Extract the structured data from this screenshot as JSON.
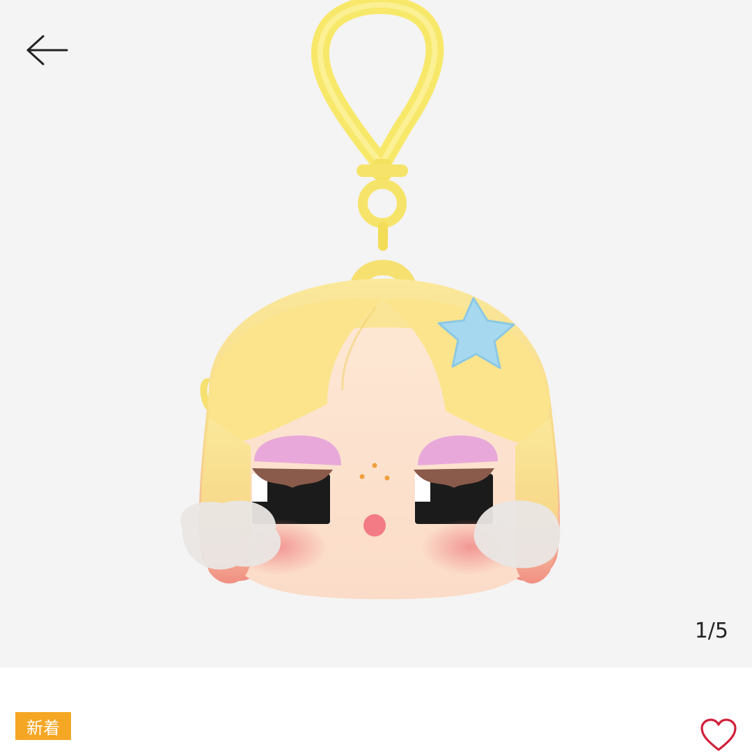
{
  "gallery": {
    "image_counter": "1/5",
    "product_image": "keychain-figure-head-image",
    "background_color": "#f4f4f4"
  },
  "header": {
    "back_icon": "arrow-left-icon"
  },
  "product": {
    "badge_label": "新着",
    "badge_color": "#f5a623"
  },
  "actions": {
    "favorite_icon": "heart-outline-icon",
    "favorite_color": "#d0203a"
  }
}
